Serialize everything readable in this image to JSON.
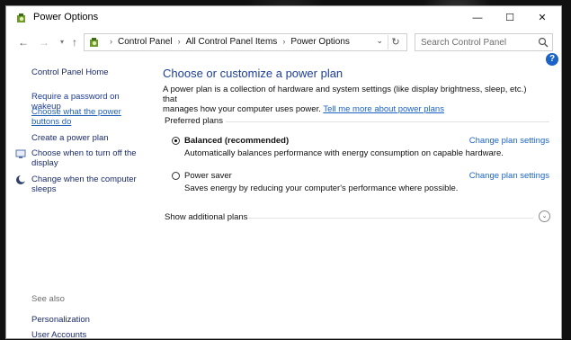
{
  "window": {
    "title": "Power Options",
    "buttons": {
      "minimize": "—",
      "maximize": "☐",
      "close": "✕"
    }
  },
  "nav": {
    "back": "←",
    "forward": "→",
    "recent": "▾",
    "up": "↑",
    "breadcrumbs": [
      "Control Panel",
      "All Control Panel Items",
      "Power Options"
    ],
    "separator": "›",
    "dropdown": "⌄",
    "refresh": "↻"
  },
  "search": {
    "placeholder": "Search Control Panel"
  },
  "help": {
    "label": "?"
  },
  "sidebar": {
    "home": "Control Panel Home",
    "links": [
      {
        "line1": "Require a password on wakeup",
        "line2": ""
      },
      {
        "line1": "Choose what the power",
        "line2": "buttons do"
      },
      {
        "line1": "Create a power plan",
        "line2": ""
      },
      {
        "line1": "Choose when to turn off the",
        "line2": "display"
      },
      {
        "line1": "Change when the computer",
        "line2": "sleeps"
      }
    ],
    "see_also": "See also",
    "see_also_links": [
      "Personalization",
      "User Accounts"
    ]
  },
  "main": {
    "heading": "Choose or customize a power plan",
    "description_line1": "A power plan is a collection of hardware and system settings (like display brightness, sleep, etc.) that",
    "description_line2": "manages how your computer uses power.",
    "description_link": "Tell me more about power plans",
    "group_label": "Preferred plans",
    "plans": [
      {
        "name": "Balanced (recommended)",
        "description": "Automatically balances performance with energy consumption on capable hardware.",
        "link": "Change plan settings",
        "selected": true
      },
      {
        "name": "Power saver",
        "description": "Saves energy by reducing your computer's performance where possible.",
        "link": "Change plan settings",
        "selected": false
      }
    ],
    "show_additional": "Show additional plans",
    "expand_glyph": "⌄"
  }
}
